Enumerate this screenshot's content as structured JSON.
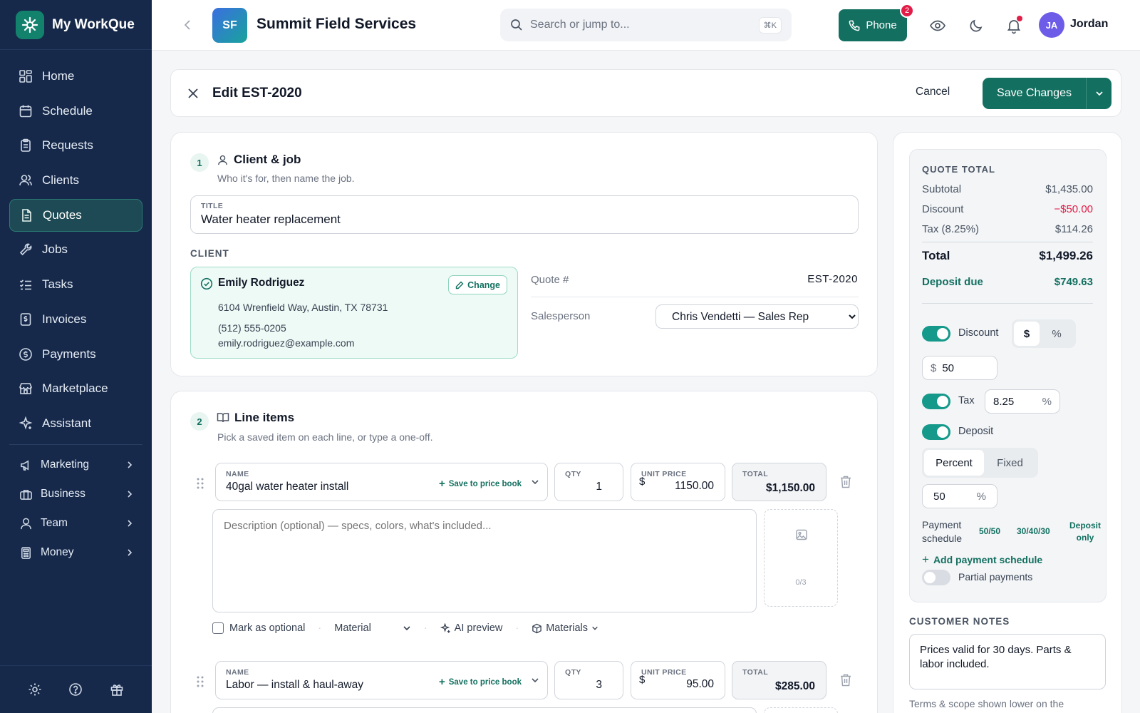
{
  "app": {
    "name": "My WorkQue"
  },
  "sidebar": {
    "items": [
      {
        "label": "Home",
        "icon": "grid-icon"
      },
      {
        "label": "Schedule",
        "icon": "calendar-icon"
      },
      {
        "label": "Requests",
        "icon": "clipboard-icon"
      },
      {
        "label": "Clients",
        "icon": "users-icon"
      },
      {
        "label": "Quotes",
        "icon": "document-icon",
        "active": true
      },
      {
        "label": "Jobs",
        "icon": "wrench-icon"
      },
      {
        "label": "Tasks",
        "icon": "checklist-icon"
      },
      {
        "label": "Invoices",
        "icon": "invoice-icon"
      },
      {
        "label": "Payments",
        "icon": "dollar-circle-icon"
      },
      {
        "label": "Marketplace",
        "icon": "store-icon"
      },
      {
        "label": "Assistant",
        "icon": "sparkle-icon"
      }
    ],
    "groups": [
      {
        "label": "Marketing",
        "icon": "megaphone-icon"
      },
      {
        "label": "Business",
        "icon": "briefcase-icon"
      },
      {
        "label": "Team",
        "icon": "user-icon"
      },
      {
        "label": "Money",
        "icon": "calculator-icon"
      }
    ],
    "footer_icons": [
      "gear-icon",
      "help-icon",
      "gift-icon"
    ]
  },
  "topbar": {
    "company_initials": "SF",
    "company_name": "Summit Field Services",
    "search_placeholder": "Search or jump to...",
    "search_shortcut": "⌘K",
    "phone_label": "Phone",
    "phone_badge": "2",
    "user_initials": "JA",
    "user_name": "Jordan"
  },
  "editor": {
    "title": "Edit EST-2020",
    "cancel_label": "Cancel",
    "save_label": "Save Changes"
  },
  "client_job": {
    "step": "1",
    "title": "Client & job",
    "subtitle": "Who it's for, then name the job.",
    "title_field_label": "TITLE",
    "title_field_value": "Water heater replacement",
    "client_caption": "CLIENT",
    "client": {
      "name": "Emily Rodriguez",
      "change_label": "Change",
      "address": "6104 Wrenfield Way, Austin, TX 78731",
      "phone": "(512) 555-0205",
      "email": "emily.rodriguez@example.com"
    },
    "quote_label": "Quote #",
    "quote_number": "EST-2020",
    "salesperson_label": "Salesperson",
    "salesperson_value": "Chris Vendetti — Sales Rep"
  },
  "line_items": {
    "step": "2",
    "title": "Line items",
    "subtitle": "Pick a saved item on each line, or type a one-off.",
    "name_label": "NAME",
    "qty_label": "QTY",
    "price_label": "UNIT PRICE",
    "total_label": "TOTAL",
    "save_to_pricebook": "Save to price book",
    "currency_symbol": "$",
    "desc_placeholder": "Description (optional) — specs, colors, what's included...",
    "image_count": "0/3",
    "optional_label": "Mark as optional",
    "type_value": "Material",
    "ai_preview_label": "AI preview",
    "materials_label": "Materials",
    "items": [
      {
        "name": "40gal water heater install",
        "qty": "1",
        "unit_price": "1150.00",
        "total": "$1,150.00"
      },
      {
        "name": "Labor — install & haul-away",
        "qty": "3",
        "unit_price": "95.00",
        "total": "$285.00"
      }
    ]
  },
  "summary": {
    "caption": "QUOTE TOTAL",
    "subtotal_label": "Subtotal",
    "subtotal": "$1,435.00",
    "discount_label": "Discount",
    "discount": "−$50.00",
    "tax_label": "Tax (8.25%)",
    "tax": "$114.26",
    "total_label": "Total",
    "total": "$1,499.26",
    "deposit_due_label": "Deposit due",
    "deposit_due": "$749.63",
    "discount_toggle_label": "Discount",
    "discount_unit_dollar": "$",
    "discount_unit_percent": "%",
    "discount_prefix": "$",
    "discount_value": "50",
    "tax_toggle_label": "Tax",
    "tax_value": "8.25",
    "tax_suffix": "%",
    "deposit_toggle_label": "Deposit",
    "deposit_mode_percent": "Percent",
    "deposit_mode_fixed": "Fixed",
    "deposit_value": "50",
    "deposit_suffix": "%",
    "payment_schedule_label": "Payment schedule",
    "schedule_options": [
      "50/50",
      "30/40/30",
      "Deposit only"
    ],
    "add_schedule_label": "Add payment schedule",
    "partial_payments_label": "Partial payments",
    "discount_enabled": true,
    "tax_enabled": true,
    "deposit_enabled": true,
    "partial_payments_enabled": false
  },
  "notes": {
    "caption": "CUSTOMER NOTES",
    "value": "Prices valid for 30 days. Parts & labor included.",
    "footer": "Terms & scope shown lower on the"
  },
  "colors": {
    "brand": "#137060",
    "sidebar": "#16294a",
    "danger": "#e11d48",
    "accent_teal": "#15998a"
  }
}
